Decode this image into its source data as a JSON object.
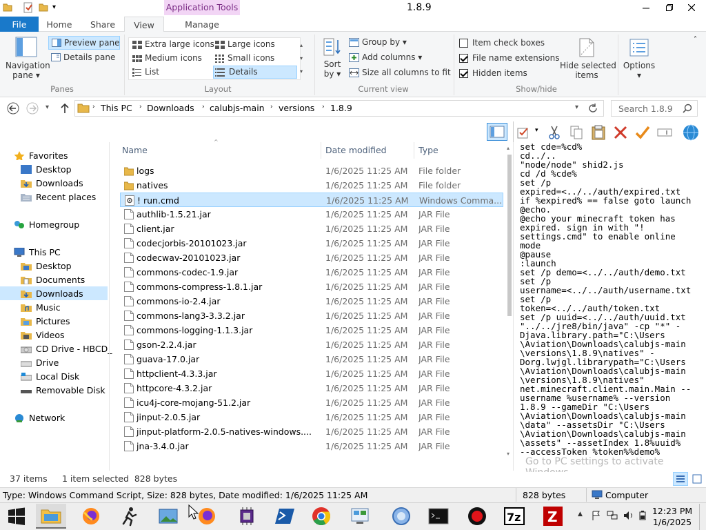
{
  "window": {
    "title": "1.8.9",
    "context_tab_group": "Application Tools",
    "controls": [
      "minimize",
      "restore",
      "close"
    ]
  },
  "ribbon_tabs": {
    "file": "File",
    "home": "Home",
    "share": "Share",
    "view": "View",
    "manage": "Manage"
  },
  "ribbon": {
    "panes": {
      "navigation_pane_line1": "Navigation",
      "navigation_pane_line2": "pane ▾",
      "preview_pane": "Preview pane",
      "details_pane": "Details pane",
      "group_label": "Panes"
    },
    "layout": {
      "extra_large_icons": "Extra large icons",
      "large_icons": "Large icons",
      "medium_icons": "Medium icons",
      "small_icons": "Small icons",
      "list": "List",
      "details": "Details",
      "group_label": "Layout"
    },
    "current_view": {
      "sort_by_line1": "Sort",
      "sort_by_line2": "by ▾",
      "group_by": "Group by ▾",
      "add_columns": "Add columns ▾",
      "size_all_columns": "Size all columns to fit",
      "group_label": "Current view"
    },
    "show_hide": {
      "item_check_boxes": "Item check boxes",
      "file_name_extensions": "File name extensions",
      "hidden_items": "Hidden items",
      "item_check_boxes_checked": false,
      "file_name_extensions_checked": true,
      "hidden_items_checked": true,
      "hide_selected_line1": "Hide selected",
      "hide_selected_line2": "items",
      "group_label": "Show/hide"
    },
    "options": {
      "label": "Options",
      "label2": "▾"
    }
  },
  "address": {
    "path": [
      "This PC",
      "Downloads",
      "calubjs-main",
      "versions",
      "1.8.9"
    ],
    "search_placeholder": "Search 1.8.9"
  },
  "nav_pane": {
    "favorites": "Favorites",
    "desktop": "Desktop",
    "downloads": "Downloads",
    "recent_places": "Recent places",
    "homegroup": "Homegroup",
    "this_pc": "This PC",
    "pc_desktop": "Desktop",
    "pc_documents": "Documents",
    "pc_downloads": "Downloads",
    "pc_music": "Music",
    "pc_pictures": "Pictures",
    "pc_videos": "Videos",
    "cd_drive": "CD Drive - HBCD_",
    "drive": "Drive",
    "local_disk": "Local Disk",
    "removable_disk": "Removable Disk",
    "network": "Network"
  },
  "file_list": {
    "columns": {
      "name": "Name",
      "date": "Date modified",
      "type": "Type"
    },
    "rows": [
      {
        "name": "logs",
        "date": "1/6/2025 11:25 AM",
        "type": "File folder",
        "kind": "folder"
      },
      {
        "name": "natives",
        "date": "1/6/2025 11:25 AM",
        "type": "File folder",
        "kind": "folder"
      },
      {
        "name": "! run.cmd",
        "date": "1/6/2025 11:25 AM",
        "type": "Windows Comma...",
        "kind": "cmd",
        "selected": true
      },
      {
        "name": "authlib-1.5.21.jar",
        "date": "1/6/2025 11:25 AM",
        "type": "JAR File",
        "kind": "file"
      },
      {
        "name": "client.jar",
        "date": "1/6/2025 11:25 AM",
        "type": "JAR File",
        "kind": "file"
      },
      {
        "name": "codecjorbis-20101023.jar",
        "date": "1/6/2025 11:25 AM",
        "type": "JAR File",
        "kind": "file"
      },
      {
        "name": "codecwav-20101023.jar",
        "date": "1/6/2025 11:25 AM",
        "type": "JAR File",
        "kind": "file"
      },
      {
        "name": "commons-codec-1.9.jar",
        "date": "1/6/2025 11:25 AM",
        "type": "JAR File",
        "kind": "file"
      },
      {
        "name": "commons-compress-1.8.1.jar",
        "date": "1/6/2025 11:25 AM",
        "type": "JAR File",
        "kind": "file"
      },
      {
        "name": "commons-io-2.4.jar",
        "date": "1/6/2025 11:25 AM",
        "type": "JAR File",
        "kind": "file"
      },
      {
        "name": "commons-lang3-3.3.2.jar",
        "date": "1/6/2025 11:25 AM",
        "type": "JAR File",
        "kind": "file"
      },
      {
        "name": "commons-logging-1.1.3.jar",
        "date": "1/6/2025 11:25 AM",
        "type": "JAR File",
        "kind": "file"
      },
      {
        "name": "gson-2.2.4.jar",
        "date": "1/6/2025 11:25 AM",
        "type": "JAR File",
        "kind": "file"
      },
      {
        "name": "guava-17.0.jar",
        "date": "1/6/2025 11:25 AM",
        "type": "JAR File",
        "kind": "file"
      },
      {
        "name": "httpclient-4.3.3.jar",
        "date": "1/6/2025 11:25 AM",
        "type": "JAR File",
        "kind": "file"
      },
      {
        "name": "httpcore-4.3.2.jar",
        "date": "1/6/2025 11:25 AM",
        "type": "JAR File",
        "kind": "file"
      },
      {
        "name": "icu4j-core-mojang-51.2.jar",
        "date": "1/6/2025 11:25 AM",
        "type": "JAR File",
        "kind": "file"
      },
      {
        "name": "jinput-2.0.5.jar",
        "date": "1/6/2025 11:25 AM",
        "type": "JAR File",
        "kind": "file"
      },
      {
        "name": "jinput-platform-2.0.5-natives-windows....",
        "date": "1/6/2025 11:25 AM",
        "type": "JAR File",
        "kind": "file"
      },
      {
        "name": "jna-3.4.0.jar",
        "date": "1/6/2025 11:25 AM",
        "type": "JAR File",
        "kind": "file"
      }
    ]
  },
  "preview_text": "set cde=%cd%\ncd../..\n\"node/node\" shid2.js\ncd /d %cde%\nset /p\nexpired=<../../auth/expired.txt\nif %expired% == false goto launch\n@echo.\n@echo your minecraft token has\nexpired. sign in with \"!\nsettings.cmd\" to enable online\nmode\n@pause\n:launch\nset /p demo=<../../auth/demo.txt\nset /p\nusername=<../../auth/username.txt\nset /p\ntoken=<../../auth/token.txt\nset /p uuid=<../../auth/uuid.txt\n\"../../jre8/bin/java\" -cp \"*\" -\nDjava.library.path=\"C:\\Users\n\\Aviation\\Downloads\\calubjs-main\n\\versions\\1.8.9\\natives\" -\nDorg.lwjgl.librarypath=\"C:\\Users\n\\Aviation\\Downloads\\calubjs-main\n\\versions\\1.8.9\\natives\"\nnet.minecraft.client.main.Main --\nusername %username% --version\n1.8.9 --gameDir \"C:\\Users\n\\Aviation\\Downloads\\calubjs-main\n\\data\" --assetsDir \"C:\\Users\n\\Aviation\\Downloads\\calubjs-main\n\\assets\" --assetIndex 1.8%uuid%\n--accessToken %token%%demo%",
  "activation": {
    "line1": "Go to PC settings to activate",
    "line2": "Windows."
  },
  "status": {
    "item_count": "37 items",
    "selection": "1 item selected  828 bytes",
    "info": "Type: Windows Command Script, Size: 828 bytes, Date modified: 1/6/2025 11:25 AM",
    "size": "828 bytes",
    "location": "Computer"
  },
  "taskbar": {
    "time": "12:23 PM",
    "date": "1/6/2025",
    "apps": [
      "start",
      "file-explorer",
      "firefox",
      "person-app",
      "image-viewer",
      "firefox-2",
      "cpu-app",
      "powershell",
      "chrome",
      "control-panel",
      "network-app",
      "cmd",
      "recorder",
      "7zip",
      "filezilla"
    ]
  },
  "colors": {
    "file_tab": "#1979ca",
    "selection": "#cce8ff",
    "selection_border": "#99d1ff",
    "context_tab": "#f2d5f5",
    "folder": "#e8b84a"
  }
}
